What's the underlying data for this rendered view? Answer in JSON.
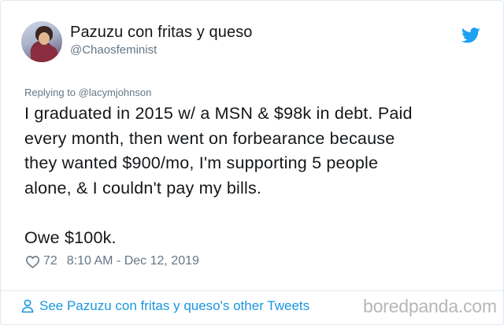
{
  "author": {
    "name": "Pazuzu con fritas y queso",
    "handle": "@Chaosfeminist",
    "avatar_icon": "profile-photo"
  },
  "brand": {
    "icon": "twitter-bird-icon",
    "color": "#1DA1F2"
  },
  "reply": {
    "prefix": "Replying to ",
    "mention": "@lacymjohnson"
  },
  "tweet": {
    "text": "I graduated in 2015 w/ a MSN & $98k in debt. Paid\nevery month, then went on forbearance because\nthey wanted $900/mo, I'm supporting 5 people\nalone, & I couldn't pay my bills.\n\nOwe $100k."
  },
  "meta": {
    "like_count": "72",
    "timestamp": "8:10 AM - Dec 12, 2019"
  },
  "footer": {
    "link_text": "See Pazuzu con fritas y queso's other Tweets",
    "link_color": "#1B95E0"
  },
  "watermark": {
    "text": "boredpanda.com"
  }
}
